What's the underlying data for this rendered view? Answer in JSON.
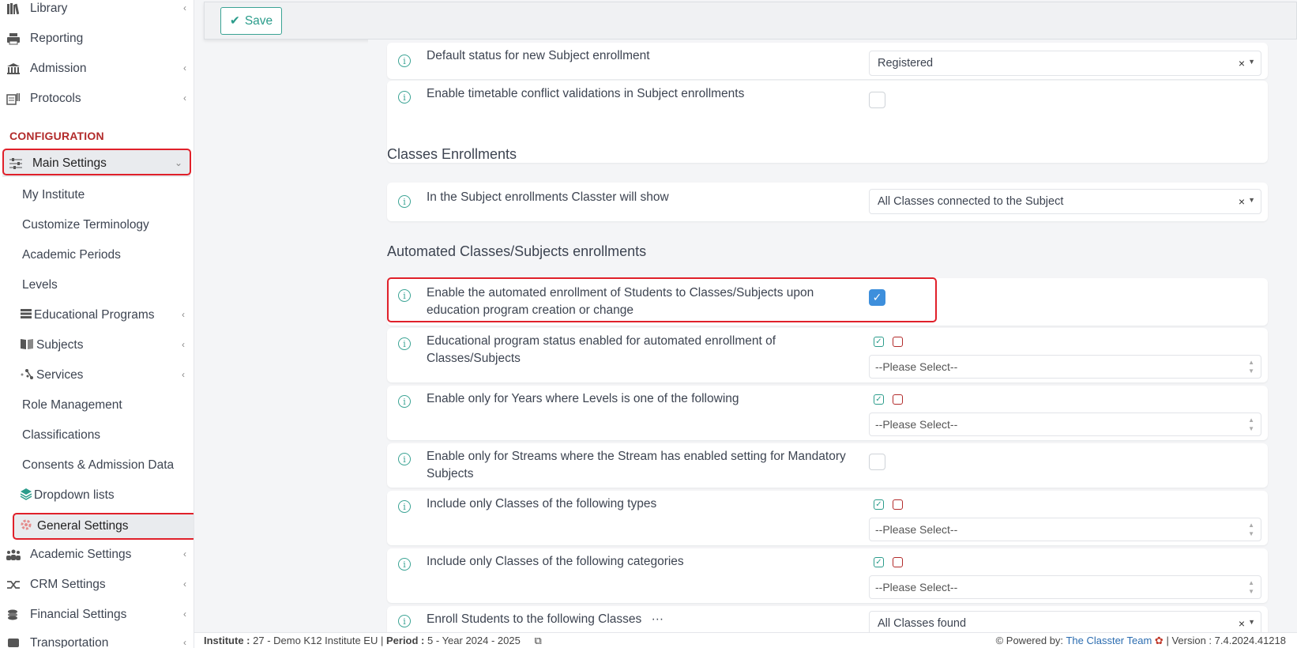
{
  "sidebar": {
    "top_items": [
      {
        "label": "Library",
        "icon": "books-icon"
      },
      {
        "label": "Reporting",
        "icon": "printer-icon"
      },
      {
        "label": "Admission",
        "icon": "institution-icon"
      },
      {
        "label": "Protocols",
        "icon": "protocols-icon"
      }
    ],
    "section_title": "CONFIGURATION",
    "main_settings": "Main Settings",
    "sub_items": [
      {
        "label": "My Institute"
      },
      {
        "label": "Customize Terminology"
      },
      {
        "label": "Academic Periods"
      },
      {
        "label": "Levels"
      },
      {
        "label": "Educational Programs"
      },
      {
        "label": "Subjects"
      },
      {
        "label": "Services"
      },
      {
        "label": "Role Management"
      },
      {
        "label": "Classifications"
      },
      {
        "label": "Consents & Admission Data"
      },
      {
        "label": "Dropdown lists"
      },
      {
        "label": "General Settings"
      }
    ],
    "bottom_items": [
      {
        "label": "Academic Settings"
      },
      {
        "label": "CRM Settings"
      },
      {
        "label": "Financial Settings"
      },
      {
        "label": "Transportation"
      }
    ]
  },
  "toolbar": {
    "save_label": "Save"
  },
  "settings": {
    "default_status_label": "Default status for new Subject enrollment",
    "default_status_value": "Registered",
    "timetable_label": "Enable timetable conflict validations in Subject enrollments",
    "classes_section": "Classes Enrollments",
    "subject_show_label": "In the Subject enrollments Classter will show",
    "subject_show_value": "All Classes connected to the Subject",
    "auto_section": "Automated Classes/Subjects enrollments",
    "auto_enable_label": "Enable the automated enrollment of Students to Classes/Subjects upon education program creation or change",
    "edu_status_label": "Educational program status enabled for automated enrollment of Classes/Subjects",
    "years_label": "Enable only for Years where Levels is one of the following",
    "streams_label": "Enable only for Streams where the Stream has enabled setting for Mandatory Subjects",
    "class_types_label": "Include only Classes of the following types",
    "class_categories_label": "Include only Classes of the following categories",
    "enroll_classes_label": "Enroll Students to the following Classes",
    "enroll_classes_value": "All Classes found",
    "please_select": "--Please Select--"
  },
  "footer": {
    "institute_label": "Institute :",
    "institute_value": "27 - Demo K12 Institute EU",
    "period_label": "Period :",
    "period_value": "5 - Year 2024 - 2025",
    "powered_label": "Powered by:",
    "powered_link": "The Classter Team",
    "version_label": "Version : 7.4.2024.41218"
  }
}
